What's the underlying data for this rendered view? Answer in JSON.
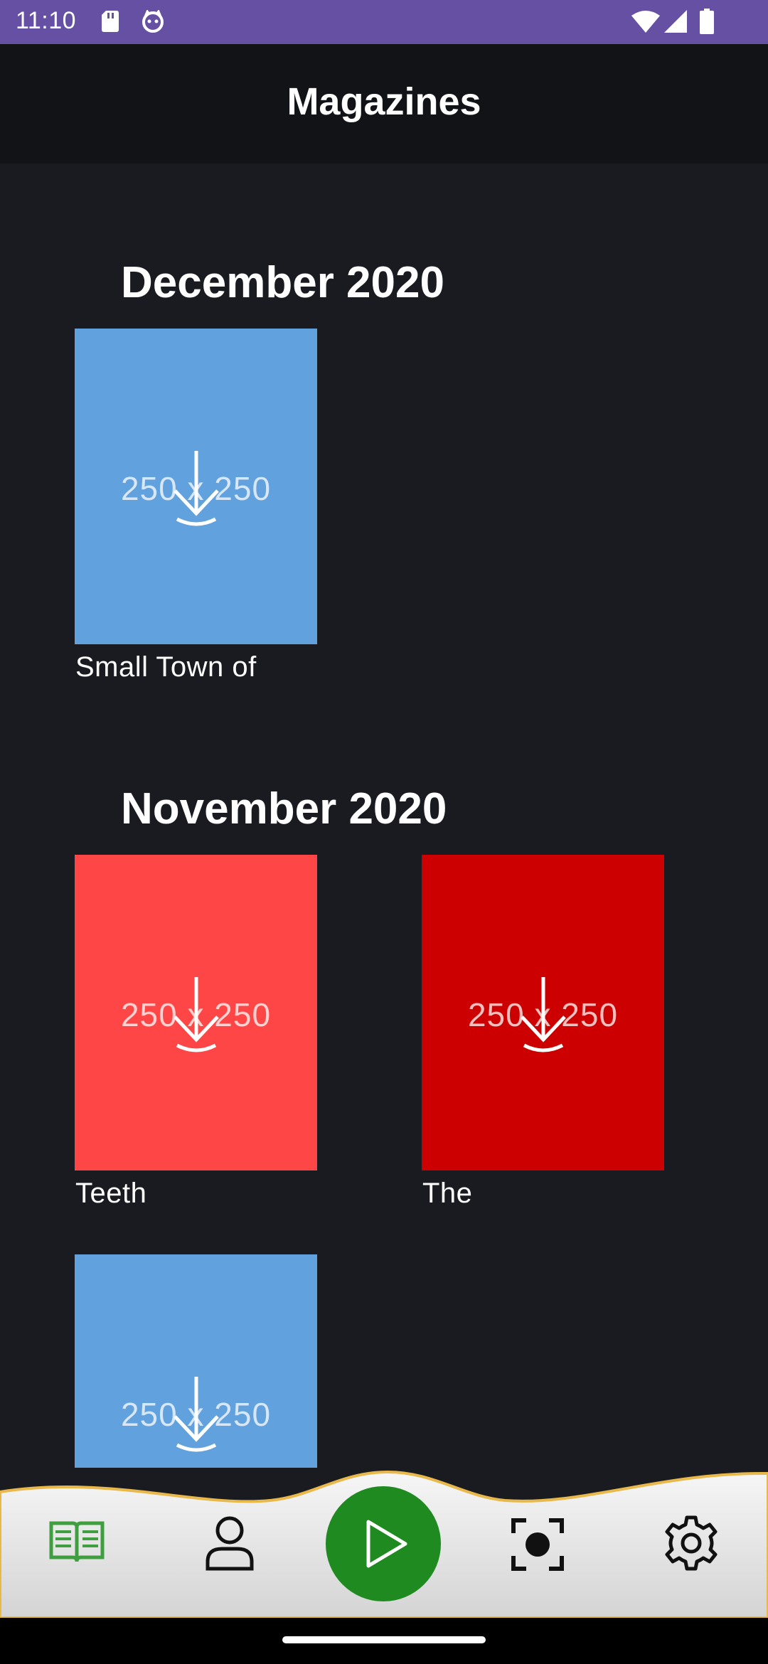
{
  "status_bar": {
    "time": "11:10"
  },
  "app_bar": {
    "title": "Magazines"
  },
  "sections": [
    {
      "title": "December 2020",
      "items": [
        {
          "caption": "Small Town of",
          "placeholder": "250 x 250",
          "color": "#60a1de"
        }
      ]
    },
    {
      "title": "November 2020",
      "items": [
        {
          "caption": "Teeth",
          "placeholder": "250 x 250",
          "color": "#ff4646"
        },
        {
          "caption": "The",
          "placeholder": "250 x 250",
          "color": "#cc0000"
        },
        {
          "caption": "",
          "placeholder": "250 x 250",
          "color": "#60a1de"
        }
      ]
    }
  ],
  "bottom_nav": {
    "items": [
      "book-icon",
      "profile-icon",
      "play-icon",
      "scan-icon",
      "gear-icon"
    ],
    "active": "book-icon",
    "accent": "#1f8a1f",
    "wave_stroke": "#e8b84a"
  }
}
